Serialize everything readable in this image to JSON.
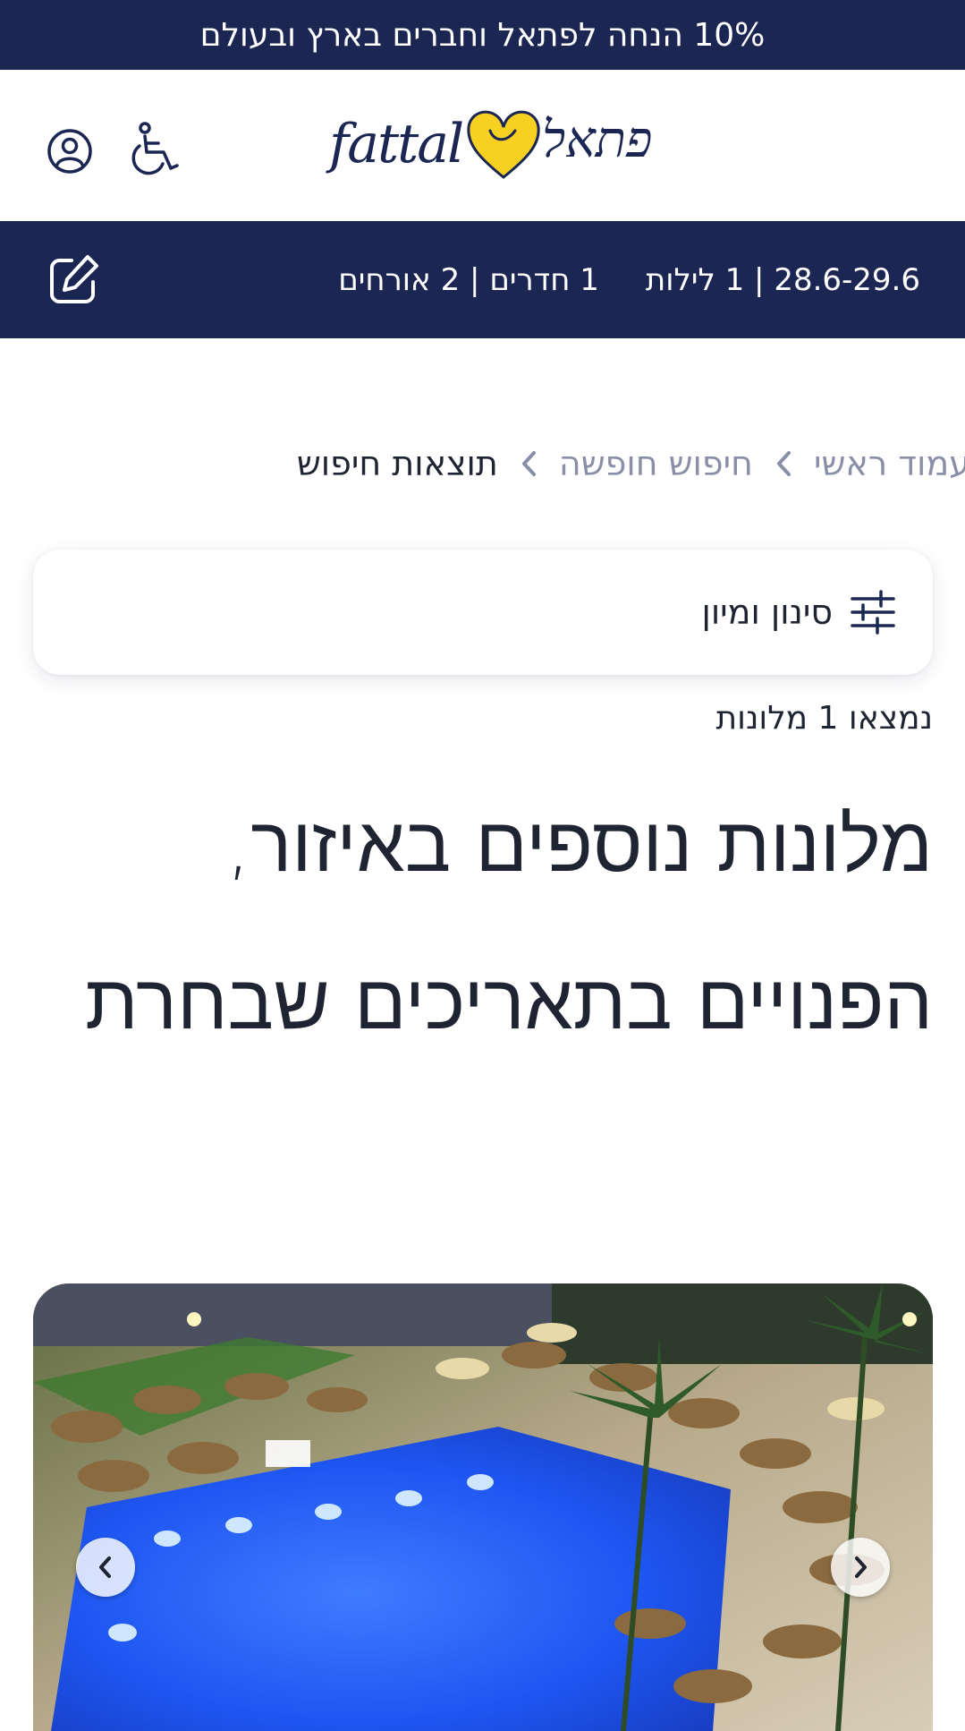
{
  "promo": {
    "text": "10% הנחה לפתאל וחברים בארץ ובעולם"
  },
  "header": {
    "logo_latin": "fattal",
    "logo_hebrew": "פתאל",
    "user_icon": "user-circle-icon",
    "accessibility_icon": "wheelchair-icon"
  },
  "search_summary": {
    "dates": "28.6-29.6",
    "nights": "1 לילות",
    "rooms": "1 חדרים",
    "guests": "2 אורחים",
    "separator": "|",
    "edit_icon": "edit-icon"
  },
  "breadcrumb": {
    "home": "עמוד ראשי",
    "search": "חיפוש חופשה",
    "current": "תוצאות חיפוש"
  },
  "filter": {
    "label": "סינון ומיון",
    "icon": "sliders-icon"
  },
  "results": {
    "count_text": "נמצאו 1 מלונות"
  },
  "section": {
    "title": "מלונות נוספים באיזור, הפנויים בתאריכים שבחרת"
  },
  "hotel_card": {
    "image_icon": "hotel-pool-photo",
    "prev_icon": "chevron-left-icon",
    "next_icon": "chevron-right-icon"
  },
  "colors": {
    "navy": "#1b2653",
    "heart_yellow": "#f7d021",
    "muted_text": "#8a8fa8",
    "body_text": "#1f2433"
  }
}
